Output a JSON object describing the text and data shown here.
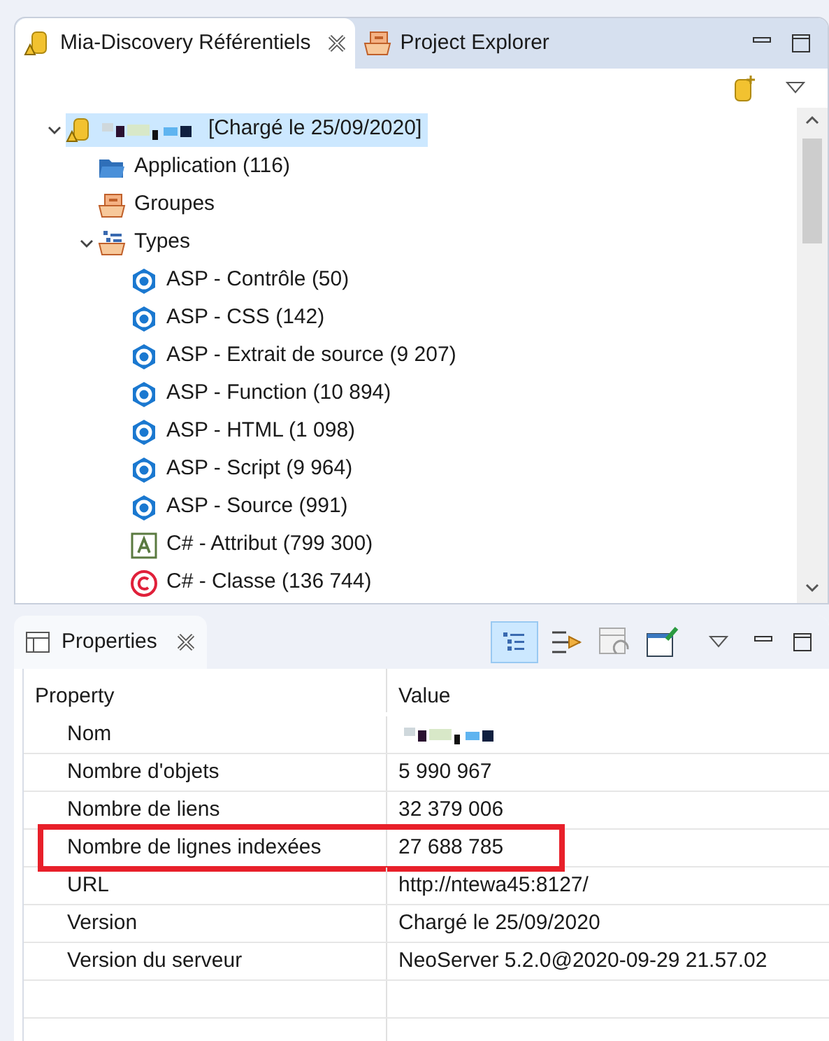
{
  "top_panel": {
    "tabs": [
      {
        "label": "Mia-Discovery Référentiels",
        "selected": true,
        "closable": true
      },
      {
        "label": "Project Explorer",
        "selected": false,
        "closable": false
      }
    ],
    "tree": [
      {
        "kind": "database",
        "label": "[Chargé le 25/09/2020]",
        "redacted": true,
        "selected": true,
        "expanded": true,
        "children": [
          {
            "kind": "folder",
            "label": "Application (116)",
            "selected": false
          },
          {
            "kind": "group",
            "label": "Groupes",
            "selected": false
          },
          {
            "kind": "types",
            "label": "Types",
            "selected": false,
            "expanded": true,
            "children": [
              {
                "kind": "asp",
                "label": "ASP - Contrôle (50)",
                "selected": false
              },
              {
                "kind": "asp",
                "label": "ASP - CSS (142)",
                "selected": false
              },
              {
                "kind": "asp",
                "label": "ASP - Extrait de source (9 207)",
                "selected": false
              },
              {
                "kind": "asp",
                "label": "ASP - Function (10 894)",
                "selected": false
              },
              {
                "kind": "asp",
                "label": "ASP - HTML (1 098)",
                "selected": false
              },
              {
                "kind": "asp",
                "label": "ASP - Script (9 964)",
                "selected": false
              },
              {
                "kind": "asp",
                "label": "ASP - Source (991)",
                "selected": false
              },
              {
                "kind": "attribute",
                "label": "C# - Attribut (799 300)",
                "selected": false
              },
              {
                "kind": "class",
                "label": "C# - Classe (136 744)",
                "selected": false
              }
            ]
          }
        ]
      }
    ]
  },
  "properties_panel": {
    "tab": {
      "label": "Properties",
      "selected": true
    },
    "columns": [
      "Property",
      "Value"
    ],
    "rows": [
      {
        "name": "Nom",
        "value_redacted": true,
        "highlighted": false
      },
      {
        "name": "Nombre d'objets",
        "value": "5 990 967",
        "highlighted": false
      },
      {
        "name": "Nombre de liens",
        "value": "32 379 006",
        "highlighted": false
      },
      {
        "name": "Nombre de lignes indexées",
        "value": "27 688 785",
        "highlighted": true
      },
      {
        "name": "URL",
        "value": "http://ntewa45:8127/",
        "highlighted": false
      },
      {
        "name": "Version",
        "value": "Chargé le 25/09/2020",
        "highlighted": false
      },
      {
        "name": "Version du serveur",
        "value": "NeoServer 5.2.0@2020-09-29 21.57.02",
        "highlighted": false
      }
    ]
  }
}
